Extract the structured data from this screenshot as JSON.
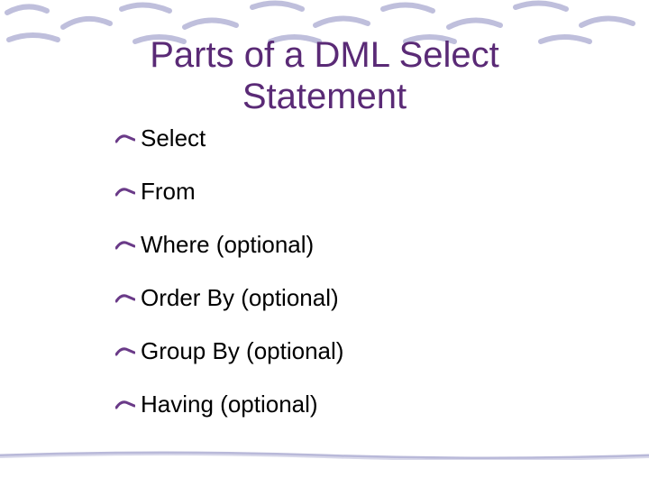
{
  "title_line1": "Parts of a DML Select",
  "title_line2": "Statement",
  "items": [
    "Select",
    "From",
    "Where (optional)",
    "Order By (optional)",
    "Group By (optional)",
    "Having (optional)"
  ]
}
